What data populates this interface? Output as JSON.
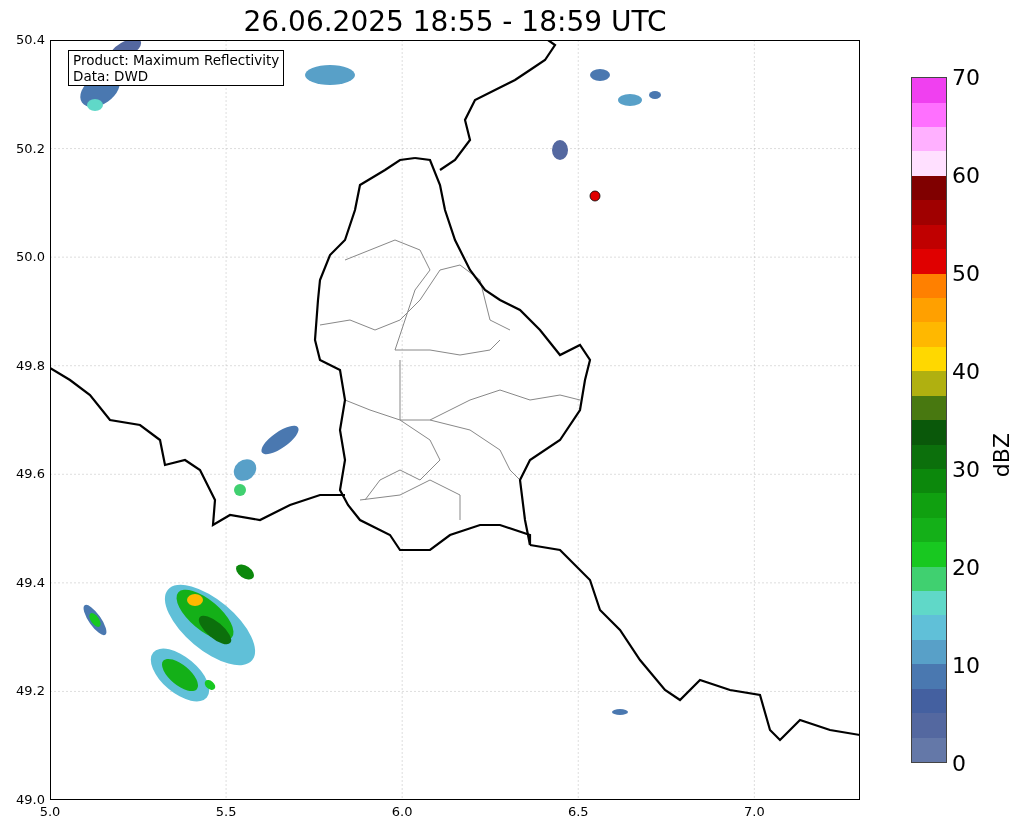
{
  "title": "26.06.2025 18:55 - 18:59 UTC",
  "info_box": [
    "Product: Maximum Reflectivity",
    "Data: DWD"
  ],
  "x_ticks": [
    "5.0",
    "5.5",
    "6.0",
    "6.5",
    "7.0"
  ],
  "y_ticks": [
    "50.4",
    "50.2",
    "50.0",
    "49.8",
    "49.6",
    "49.4",
    "49.2",
    "49.0"
  ],
  "colorbar": {
    "label": "dBZ",
    "ticks": [
      "70",
      "60",
      "50",
      "40",
      "30",
      "20",
      "10",
      "0"
    ],
    "bands": [
      {
        "color": "#6478a8"
      },
      {
        "color": "#5468a0"
      },
      {
        "color": "#4460a0"
      },
      {
        "color": "#4a78b0"
      },
      {
        "color": "#58a0c8"
      },
      {
        "color": "#60c0d8"
      },
      {
        "color": "#60d8c8"
      },
      {
        "color": "#40d070"
      },
      {
        "color": "#18c820"
      },
      {
        "color": "#14b018"
      },
      {
        "color": "#10a010"
      },
      {
        "color": "#0c880c"
      },
      {
        "color": "#0c700c"
      },
      {
        "color": "#0a580a"
      },
      {
        "color": "#487810"
      },
      {
        "color": "#b0b010"
      },
      {
        "color": "#ffd800"
      },
      {
        "color": "#ffb800"
      },
      {
        "color": "#ffa000"
      },
      {
        "color": "#ff8000"
      },
      {
        "color": "#e00000"
      },
      {
        "color": "#c00000"
      },
      {
        "color": "#a00000"
      },
      {
        "color": "#800000"
      },
      {
        "color": "#ffe0ff"
      },
      {
        "color": "#ffb0ff"
      },
      {
        "color": "#ff70ff"
      },
      {
        "color": "#f040f0"
      }
    ]
  }
}
